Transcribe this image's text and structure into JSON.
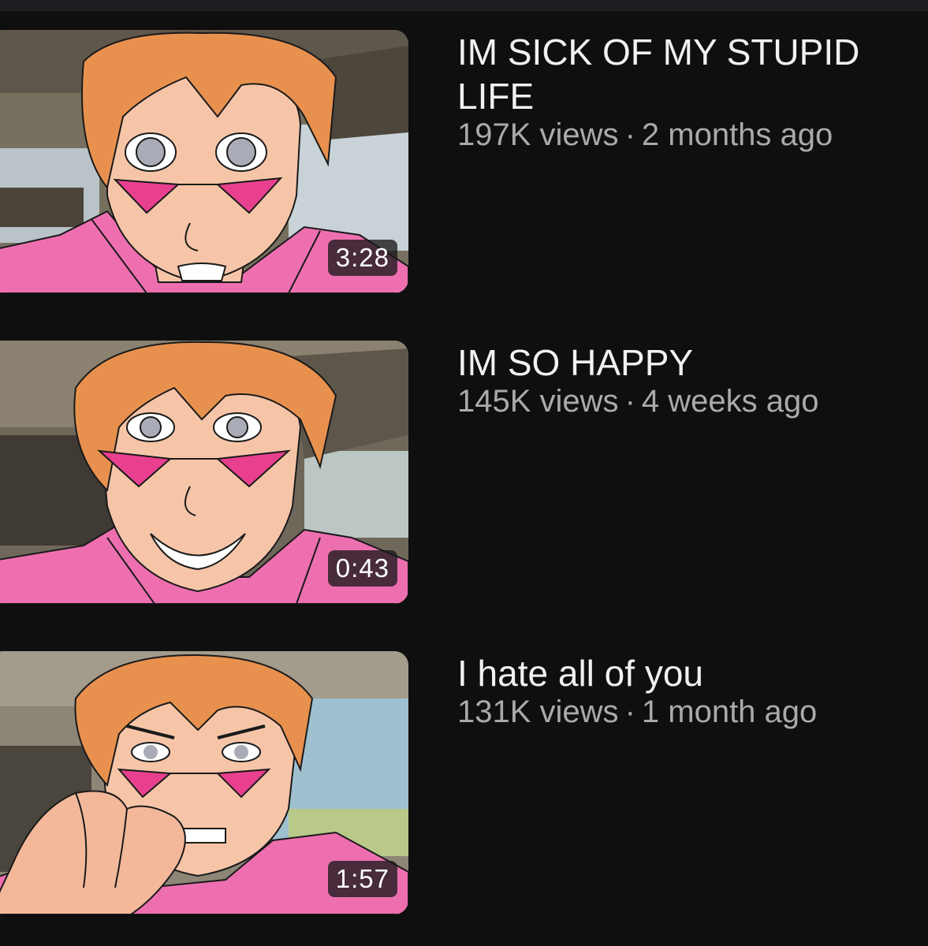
{
  "videos": [
    {
      "title": "IM SICK OF MY STUPID LIFE",
      "views": "197K views",
      "age": "2 months ago",
      "duration": "3:28",
      "thumbnail_expression": "anxious",
      "thumbnail_hand": false
    },
    {
      "title": "IM SO HAPPY",
      "views": "145K views",
      "age": "4 weeks ago",
      "duration": "0:43",
      "thumbnail_expression": "grinning",
      "thumbnail_hand": false
    },
    {
      "title": "I hate all of you",
      "views": "131K views",
      "age": "1 month ago",
      "duration": "1:57",
      "thumbnail_expression": "angry",
      "thumbnail_hand": true
    }
  ],
  "colors": {
    "background": "#0f0f0f",
    "title": "#f1f1f1",
    "meta": "#aaaaaa",
    "hair": "#e8914f",
    "skin": "#f6c5a8",
    "jacket": "#ee6fb0",
    "glasses": "#e8408e",
    "car_interior": "#6b6256"
  }
}
